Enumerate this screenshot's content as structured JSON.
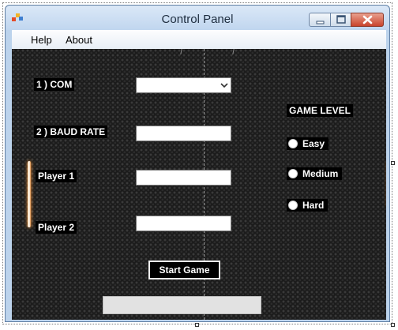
{
  "window": {
    "title": "Control Panel",
    "icon": "windows-form-icon"
  },
  "menu": {
    "items": [
      {
        "label": "Help"
      },
      {
        "label": "About"
      }
    ]
  },
  "form": {
    "com_label": "1 ) COM",
    "com_value": "",
    "baud_label": "2 ) BAUD RATE",
    "baud_value": "",
    "player1_label": "Player 1",
    "player1_value": "",
    "player2_label": "Player 2",
    "player2_value": ""
  },
  "game_level": {
    "title": "GAME LEVEL",
    "options": [
      {
        "label": "Easy",
        "selected": false
      },
      {
        "label": "Medium",
        "selected": false
      },
      {
        "label": "Hard",
        "selected": false
      }
    ]
  },
  "start_button_label": "Start Game",
  "progress": {
    "value": 0
  },
  "colors": {
    "background": "#1c1c1c",
    "paddle_glow": "#ff9a3c",
    "accent": "#ffffff"
  }
}
